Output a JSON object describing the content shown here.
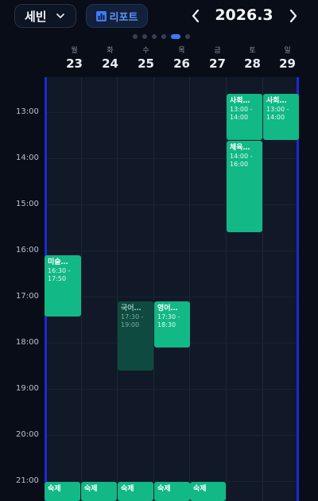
{
  "header": {
    "profile_name": "세빈",
    "report_label": "리포트",
    "month": "2026.3"
  },
  "colors": {
    "accent": "#3d7bff",
    "event": "#12b886",
    "event_faded": "#0f4a40",
    "grid_edge": "#1a2bd6"
  },
  "days": [
    {
      "name": "월",
      "num": "23"
    },
    {
      "name": "화",
      "num": "24"
    },
    {
      "name": "수",
      "num": "25"
    },
    {
      "name": "목",
      "num": "26"
    },
    {
      "name": "금",
      "num": "27"
    },
    {
      "name": "토",
      "num": "28"
    },
    {
      "name": "일",
      "num": "29"
    }
  ],
  "times": [
    "13:00",
    "14:00",
    "15:00",
    "16:00",
    "17:00",
    "18:00",
    "19:00",
    "20:00",
    "21:00"
  ],
  "events": [
    {
      "title": "사회…",
      "time1": "13:00 -",
      "time2": "14:00"
    },
    {
      "title": "사회…",
      "time1": "13:00 -",
      "time2": "14:00"
    },
    {
      "title": "체육…",
      "time1": "14:00 -",
      "time2": "16:00"
    },
    {
      "title": "미술…",
      "time1": "16:30 -",
      "time2": "17:50"
    },
    {
      "title": "국어…",
      "time1": "17:30 -",
      "time2": "19:00"
    },
    {
      "title": "영어…",
      "time1": "17:30 -",
      "time2": "18:30"
    },
    {
      "title": "숙제"
    },
    {
      "title": "숙제"
    },
    {
      "title": "숙제"
    },
    {
      "title": "숙제"
    },
    {
      "title": "숙제"
    }
  ]
}
